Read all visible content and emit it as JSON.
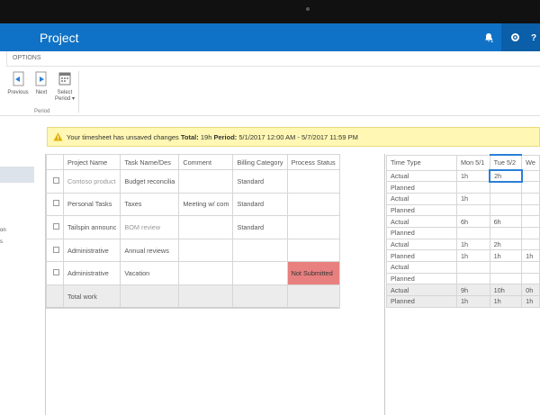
{
  "suite": {
    "title": "Project",
    "notification_count": "1"
  },
  "ribbon": {
    "tab_options": "OPTIONS",
    "buttons": [
      {
        "label": "Previous"
      },
      {
        "label": "Next"
      },
      {
        "label": "Select Period ▾"
      }
    ],
    "group_label": "Period"
  },
  "leftnav": {
    "text1": "on",
    "text2": "s"
  },
  "alert": {
    "prefix": "Your timesheet has unsaved changes ",
    "total_label": "Total:",
    "total_value": " 19h ",
    "period_label": "Period:",
    "period_value": " 5/1/2017 12:00 AM - 5/7/2017 11:59 PM"
  },
  "left_grid": {
    "headers": [
      "",
      "Project Name",
      "Task Name/Des",
      "Comment",
      "Billing Category",
      "Process Status"
    ],
    "rows": [
      {
        "project": "Contoso product",
        "task": "Budget reconcilia",
        "comment": "",
        "billing": "Standard",
        "status": ""
      },
      {
        "project": "Personal Tasks",
        "task": "Taxes",
        "comment": "Meeting w/ com",
        "billing": "Standard",
        "status": ""
      },
      {
        "project": "Tailspin announc",
        "task": "BOM review",
        "comment": "",
        "billing": "Standard",
        "status": ""
      },
      {
        "project": "Administrative",
        "task": "Annual reviews",
        "comment": "",
        "billing": "",
        "status": ""
      },
      {
        "project": "Administrative",
        "task": "Vacation",
        "comment": "",
        "billing": "",
        "status": "Not Submitted"
      }
    ],
    "total_label": "Total work"
  },
  "right_grid": {
    "headers": [
      "Time Type",
      "Mon 5/1",
      "Tue 5/2",
      "We"
    ],
    "rows": [
      [
        "Actual",
        "1h",
        "2h",
        ""
      ],
      [
        "Planned",
        "",
        "",
        ""
      ],
      [
        "Actual",
        "1h",
        "",
        ""
      ],
      [
        "Planned",
        "",
        "",
        ""
      ],
      [
        "Actual",
        "6h",
        "6h",
        ""
      ],
      [
        "Planned",
        "",
        "",
        ""
      ],
      [
        "Actual",
        "1h",
        "2h",
        ""
      ],
      [
        "Planned",
        "1h",
        "1h",
        "1h"
      ],
      [
        "Actual",
        "",
        "",
        ""
      ],
      [
        "Planned",
        "",
        "",
        ""
      ]
    ],
    "totals": [
      [
        "Actual",
        "9h",
        "10h",
        "0h"
      ],
      [
        "Planned",
        "1h",
        "1h",
        "1h"
      ]
    ]
  },
  "colors": {
    "suite_blue": "#0f72c6",
    "alert_yellow": "#fff7b3",
    "not_submitted": "#e8807f",
    "selection_blue": "#2a7fd6"
  }
}
